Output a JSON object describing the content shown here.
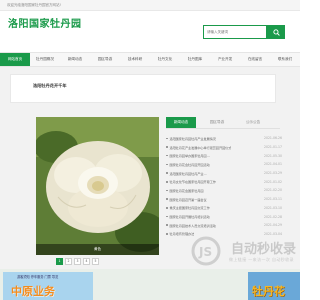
{
  "topbar": {
    "text": "欢迎光临洛阳国家牡丹园官方网站!"
  },
  "header": {
    "logo": "洛阳国家牡丹园",
    "search_placeholder": "请输入关键词"
  },
  "nav": {
    "items": [
      {
        "label": "网站首页",
        "active": true
      },
      {
        "label": "牡丹园概况"
      },
      {
        "label": "新闻动态"
      },
      {
        "label": "园区导游"
      },
      {
        "label": "技术科研"
      },
      {
        "label": "牡丹文化"
      },
      {
        "label": "牡丹图库"
      },
      {
        "label": "产业开发"
      },
      {
        "label": "在线留言"
      },
      {
        "label": "联系我们"
      }
    ]
  },
  "article": {
    "title": "洛阳牡丹花开千年"
  },
  "photo": {
    "caption": "黄色"
  },
  "tabs": [
    {
      "label": "新闻动态",
      "active": true
    },
    {
      "label": "园区导游"
    },
    {
      "label": "公示公告"
    }
  ],
  "news": [
    {
      "title": "洛阳国家牡丹园牡丹产业发展情况",
      "date": "2021-06-26"
    },
    {
      "title": "洛阳牡丹花产业发展中心举行观赏园开园仪式",
      "date": "2021-01-17"
    },
    {
      "title": "国家牡丹园举办国家牡丹园…",
      "date": "2021-05-30"
    },
    {
      "title": "国家牡丹花会牡丹园开园活动",
      "date": "2021-04-01"
    },
    {
      "title": "洛阳国家牡丹园牡丹产业…",
      "date": "2021-03-29"
    },
    {
      "title": "牡丹文化节在国家牡丹园开幕工作",
      "date": "2021-01-02"
    },
    {
      "title": "国家牡丹花会国家牡丹园",
      "date": "2021-02-20"
    },
    {
      "title": "国家牡丹园召开第一届会议",
      "date": "2021-03-11"
    },
    {
      "title": "重庆主题国家牡丹园交流工作",
      "date": "2021-03-10"
    },
    {
      "title": "国家牡丹园开展牡丹培训活动",
      "date": "2021-02-28"
    },
    {
      "title": "国家牡丹园技术人员交流培训活动",
      "date": "2021-04-29"
    },
    {
      "title": "牡丹培育管理办法",
      "date": "2021-03-04"
    }
  ],
  "pager": [
    "1",
    "2",
    "3",
    "4",
    "5"
  ],
  "watermark": {
    "line1": "自动秒收录",
    "line2": "做上链接 一来访一次 自动秒收录"
  },
  "banners": {
    "left_small": "游客须知 停车服务 门票 导览",
    "left_big": "中原业务",
    "right_big": "牡丹花"
  },
  "colors": {
    "accent": "#1a9a4a"
  }
}
